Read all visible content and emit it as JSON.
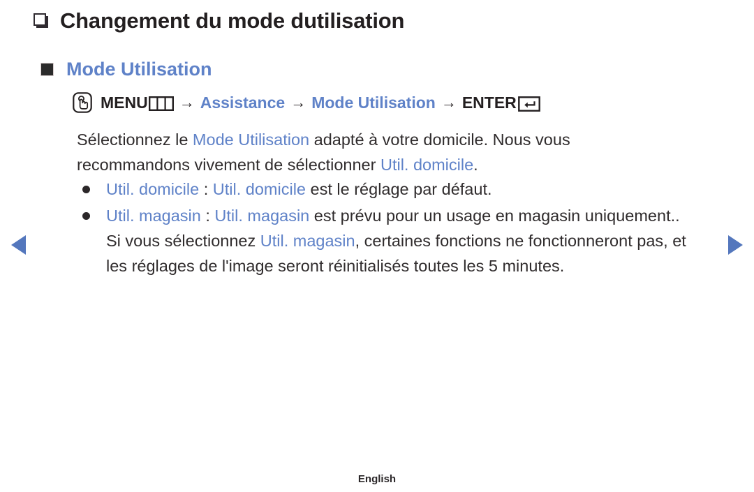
{
  "page": {
    "title": "Changement du mode dutilisation",
    "title_bullet_icon": "hollow-square-bullet-icon",
    "footer_language": "English"
  },
  "colors": {
    "accent_blue": "#5f82c8",
    "arrow_blue": "#5477bd",
    "text_black": "#302c2d",
    "bullet_dark": "#2b2729"
  },
  "section": {
    "bullet_icon": "filled-square-bullet-icon",
    "heading": "Mode Utilisation"
  },
  "menu_path": {
    "touch_icon": "touch-button-icon",
    "menu_label": "MENU",
    "menu_icon": "menu-three-column-icon",
    "arrow": "→",
    "step_assistance": "Assistance",
    "step_mode_utilisation": "Mode Utilisation",
    "enter_label": "ENTER",
    "enter_icon": "enter-return-icon"
  },
  "paragraph": {
    "part1": "Sélectionnez le ",
    "highlight1": "Mode Utilisation",
    "part2": " adapté à votre domicile. Nous vous recommandons vivement de sélectionner ",
    "highlight2": "Util. domicile",
    "part3": "."
  },
  "bullets": [
    {
      "dot_icon": "round-bullet-icon",
      "term": "Util. domicile",
      "separator": " : ",
      "highlight": "Util. domicile",
      "rest": " est le réglage par défaut."
    },
    {
      "dot_icon": "round-bullet-icon",
      "term": "Util. magasin",
      "separator": " : ",
      "highlight": "Util. magasin",
      "rest": " est prévu pour un usage en magasin uniquement.. Si vous sélectionnez ",
      "highlight2": "Util. magasin",
      "rest2": ", certaines fonctions ne fonctionneront pas, et les réglages de l'image seront réinitialisés toutes les 5 minutes."
    }
  ],
  "navigation": {
    "prev_label": "previous-page",
    "next_label": "next-page"
  }
}
